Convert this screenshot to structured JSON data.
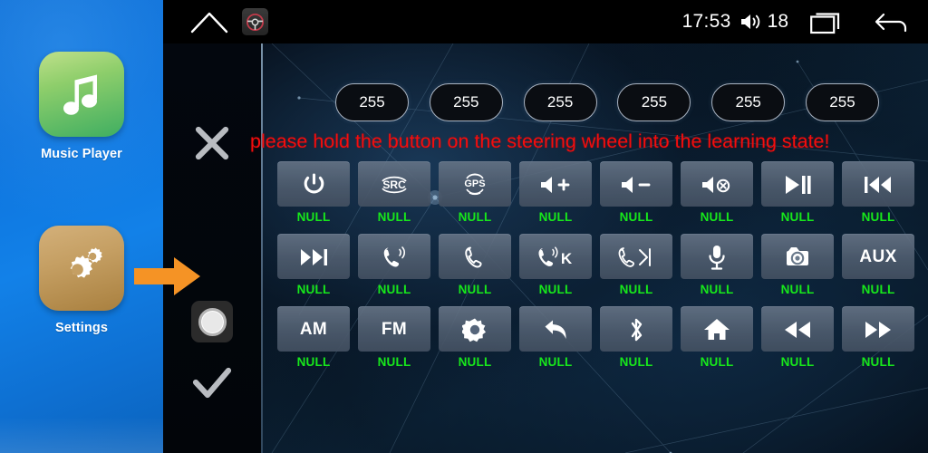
{
  "sidebar": {
    "apps": [
      {
        "id": "music-player",
        "label": "Music Player",
        "icon": "music-note-icon"
      },
      {
        "id": "settings",
        "label": "Settings",
        "icon": "gears-icon"
      }
    ]
  },
  "statusbar": {
    "home_icon": "home-outline-icon",
    "steering_wheel_icon": "steering-wheel-icon",
    "time": "17:53",
    "volume_icon": "volume-speaker-icon",
    "volume_level": "18",
    "recents_icon": "recents-icon",
    "back_icon": "back-arrow-icon"
  },
  "controls": {
    "cancel_icon": "close-x-icon",
    "cursor_icon": "cursor-circle-icon",
    "confirm_icon": "checkmark-icon",
    "pointer_icon": "orange-arrow-icon"
  },
  "pills": {
    "values": [
      "255",
      "255",
      "255",
      "255",
      "255",
      "255"
    ]
  },
  "warning": {
    "message": "please hold the button on the steering wheel into the learning state!",
    "color": "#f40d0d"
  },
  "grid": {
    "null_label": "NULL",
    "rows": [
      [
        {
          "icon": "power-icon",
          "text": "",
          "status": "NULL"
        },
        {
          "icon": "src-icon",
          "text": "SRC",
          "status": "NULL"
        },
        {
          "icon": "gps-icon",
          "text": "GPS",
          "status": "NULL"
        },
        {
          "icon": "volume-up-icon",
          "text": "",
          "status": "NULL"
        },
        {
          "icon": "volume-down-icon",
          "text": "",
          "status": "NULL"
        },
        {
          "icon": "volume-mute-icon",
          "text": "",
          "status": "NULL"
        },
        {
          "icon": "play-pause-icon",
          "text": "",
          "status": "NULL"
        },
        {
          "icon": "previous-track-icon",
          "text": "",
          "status": "NULL"
        }
      ],
      [
        {
          "icon": "next-track-icon",
          "text": "",
          "status": "NULL"
        },
        {
          "icon": "answer-call-icon",
          "text": "",
          "status": "NULL"
        },
        {
          "icon": "hang-up-icon",
          "text": "",
          "status": "NULL"
        },
        {
          "icon": "call-k-icon",
          "text": "K",
          "status": "NULL"
        },
        {
          "icon": "hang-up-skip-icon",
          "text": "",
          "status": "NULL"
        },
        {
          "icon": "microphone-icon",
          "text": "",
          "status": "NULL"
        },
        {
          "icon": "camera-icon",
          "text": "",
          "status": "NULL"
        },
        {
          "icon": "aux-icon",
          "text": "AUX",
          "status": "NULL"
        }
      ],
      [
        {
          "icon": "am-icon",
          "text": "AM",
          "status": "NULL"
        },
        {
          "icon": "fm-icon",
          "text": "FM",
          "status": "NULL"
        },
        {
          "icon": "brightness-icon",
          "text": "",
          "status": "NULL"
        },
        {
          "icon": "back-curve-icon",
          "text": "",
          "status": "NULL"
        },
        {
          "icon": "bluetooth-icon",
          "text": "",
          "status": "NULL"
        },
        {
          "icon": "home-icon",
          "text": "",
          "status": "NULL"
        },
        {
          "icon": "rewind-icon",
          "text": "",
          "status": "NULL"
        },
        {
          "icon": "fast-forward-icon",
          "text": "",
          "status": "NULL"
        }
      ]
    ]
  },
  "colors": {
    "accent_orange": "#f59325",
    "status_green": "#17e81b",
    "warning_red": "#f40d0d",
    "sidebar_blue": "#0d73dd"
  }
}
